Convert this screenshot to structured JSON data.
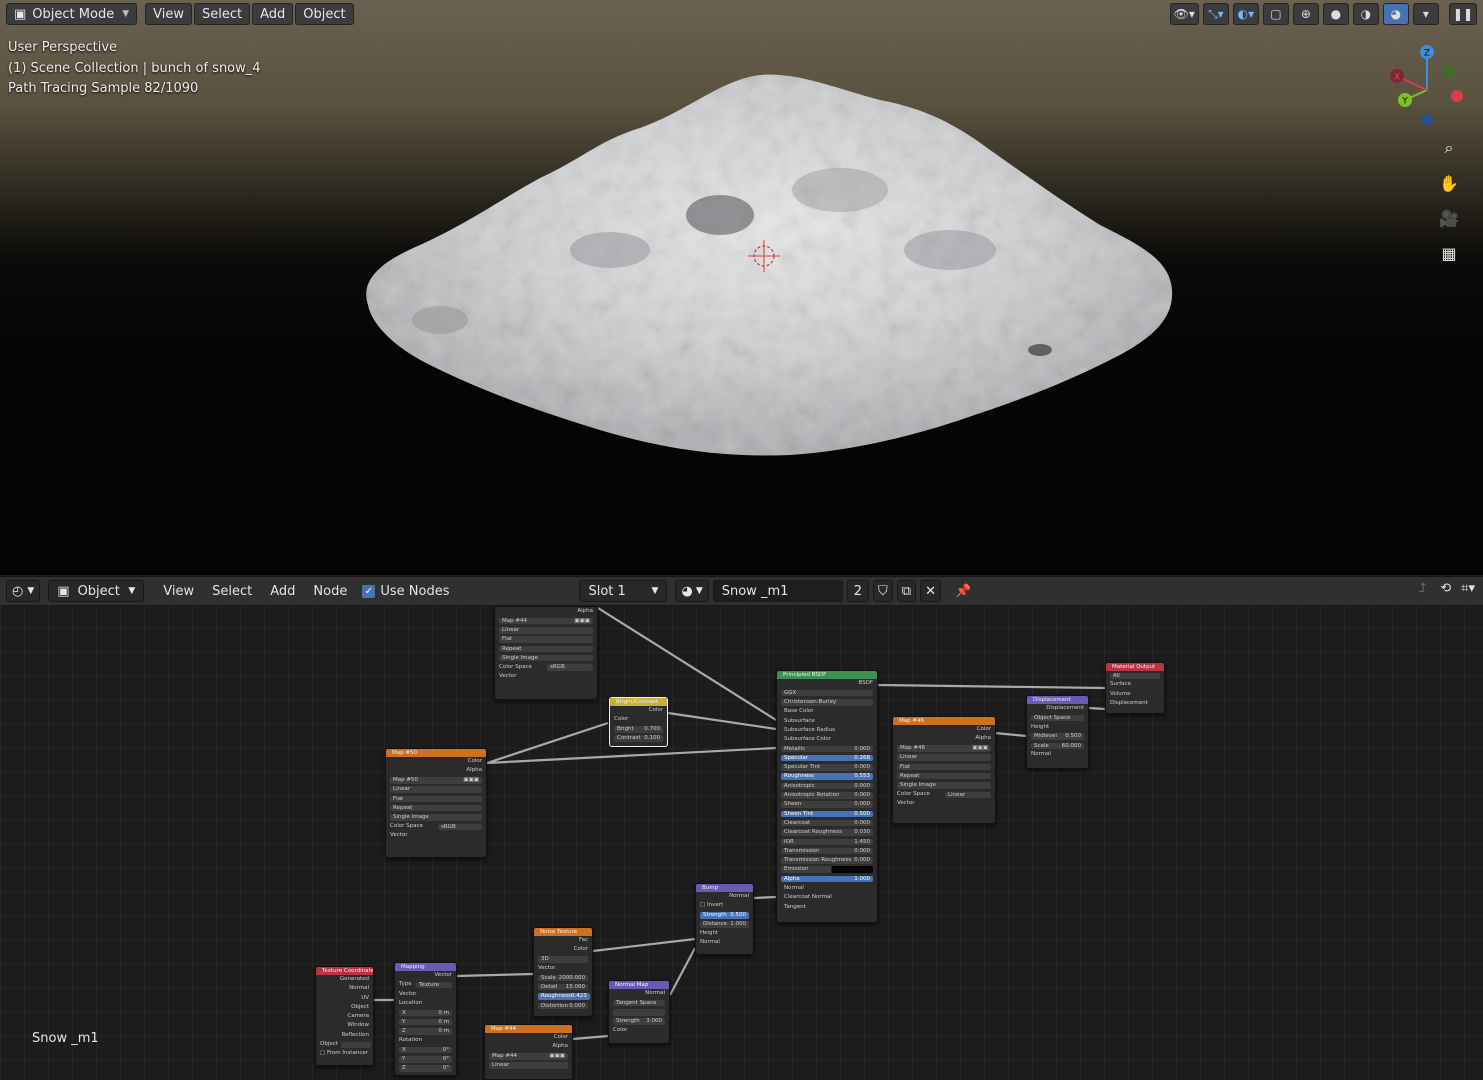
{
  "viewport": {
    "mode_label": "Object Mode",
    "menus": [
      "View",
      "Select",
      "Add",
      "Object"
    ],
    "overlay": {
      "perspective": "User Perspective",
      "collection": "(1) Scene Collection | bunch of snow_4",
      "sample": "Path Tracing Sample 82/1090"
    },
    "gizmo": {
      "x": "X",
      "y": "Y",
      "z": "Z"
    },
    "nav_tools": [
      "zoom-icon",
      "pan-hand-icon",
      "camera-icon",
      "grid-ortho-icon"
    ]
  },
  "node_editor": {
    "object_label": "Object",
    "menus": [
      "View",
      "Select",
      "Add",
      "Node"
    ],
    "use_nodes_label": "Use Nodes",
    "slot_label": "Slot 1",
    "material_name": "Snow _m1",
    "user_count": "2",
    "footer_material": "Snow _m1"
  },
  "nodes": {
    "map44top": {
      "title": "",
      "alpha": "Alpha",
      "img": "Map #44",
      "interp": "Linear",
      "proj": "Flat",
      "ext": "Repeat",
      "src": "Single Image",
      "cs_label": "Color Space",
      "cs_val": "sRGB",
      "vector": "Vector"
    },
    "bright": {
      "title": "Bright/Contrast",
      "color_out": "Color",
      "color_in": "Color",
      "bright": "Bright",
      "bright_val": "0.700",
      "contrast": "Contrast",
      "contrast_val": "0.100"
    },
    "map50": {
      "title": "Map #50",
      "color": "Color",
      "alpha": "Alpha",
      "img": "Map #50",
      "interp": "Linear",
      "proj": "Flat",
      "ext": "Repeat",
      "src": "Single Image",
      "cs_label": "Color Space",
      "cs_val": "sRGB",
      "vector": "Vector"
    },
    "principled": {
      "title": "Principled BSDF",
      "out": "BSDF",
      "dist": "GGX",
      "sss": "Christensen-Burley",
      "rows": [
        {
          "l": "Base Color",
          "v": ""
        },
        {
          "l": "Subsurface",
          "v": ""
        },
        {
          "l": "Subsurface Radius",
          "v": ""
        },
        {
          "l": "Subsurface Color",
          "v": ""
        },
        {
          "l": "Metallic",
          "v": "0.000"
        },
        {
          "l": "Specular",
          "v": "0.268"
        },
        {
          "l": "Specular Tint",
          "v": "0.000"
        },
        {
          "l": "Roughness",
          "v": "0.553"
        },
        {
          "l": "Anisotropic",
          "v": "0.000"
        },
        {
          "l": "Anisotropic Rotation",
          "v": "0.000"
        },
        {
          "l": "Sheen",
          "v": "0.000"
        },
        {
          "l": "Sheen Tint",
          "v": "0.500"
        },
        {
          "l": "Clearcoat",
          "v": "0.000"
        },
        {
          "l": "Clearcoat Roughness",
          "v": "0.030"
        },
        {
          "l": "IOR",
          "v": "1.450"
        },
        {
          "l": "Transmission",
          "v": "0.000"
        },
        {
          "l": "Transmission Roughness",
          "v": "0.000"
        },
        {
          "l": "Emission",
          "v": ""
        },
        {
          "l": "Alpha",
          "v": "1.000"
        },
        {
          "l": "Normal",
          "v": ""
        },
        {
          "l": "Clearcoat Normal",
          "v": ""
        },
        {
          "l": "Tangent",
          "v": ""
        }
      ]
    },
    "map46": {
      "title": "Map #46",
      "color": "Color",
      "alpha": "Alpha",
      "img": "Map #46",
      "interp": "Linear",
      "proj": "Flat",
      "ext": "Repeat",
      "src": "Single Image",
      "cs_label": "Color Space",
      "cs_val": "Linear",
      "vector": "Vector"
    },
    "displacement": {
      "title": "Displacement",
      "out": "Displacement",
      "space": "Object Space",
      "height": "Height",
      "mid": "Midlevel",
      "mid_val": "0.500",
      "scale": "Scale",
      "scale_val": "60.000",
      "normal": "Normal"
    },
    "matout": {
      "title": "Material Output",
      "target": "All",
      "surface": "Surface",
      "volume": "Volume",
      "disp": "Displacement"
    },
    "bump": {
      "title": "Bump",
      "normal_out": "Normal",
      "invert": "Invert",
      "strength": "Strength",
      "strength_val": "0.500",
      "distance": "Distance",
      "distance_val": "1.000",
      "height": "Height",
      "normal": "Normal"
    },
    "noise": {
      "title": "Noise Texture",
      "fac": "Fac",
      "color": "Color",
      "dim": "3D",
      "vector": "Vector",
      "scale": "Scale",
      "scale_val": "2000.000",
      "detail": "Detail",
      "detail_val": "15.000",
      "rough": "Roughness",
      "rough_val": "0.423",
      "distortion": "Distortion",
      "distortion_val": "0.000"
    },
    "normalmap": {
      "title": "Normal Map",
      "normal_out": "Normal",
      "space": "Tangent Space",
      "strength": "Strength",
      "strength_val": "3.000",
      "color": "Color"
    },
    "texcoord": {
      "title": "Texture Coordinate",
      "outs": [
        "Generated",
        "Normal",
        "UV",
        "Object",
        "Camera",
        "Window",
        "Reflection"
      ],
      "object_label": "Object",
      "instancer": "From Instancer"
    },
    "mapping": {
      "title": "Mapping",
      "vector_out": "Vector",
      "type_label": "Type",
      "type_val": "Texture",
      "vector_in": "Vector",
      "location": "Location",
      "rotation": "Rotation",
      "lx": "0 m",
      "ly": "0 m",
      "lz": "0 m",
      "rx": "0°",
      "ry": "0°",
      "rz": "0°",
      "x": "X",
      "y": "Y",
      "z": "Z"
    },
    "map44b": {
      "title": "Map #44",
      "color": "Color",
      "alpha": "Alpha",
      "img": "Map #44",
      "interp": "Linear"
    }
  },
  "colors": {
    "texture_header": "#d0701f",
    "shader_header": "#3d9150",
    "vector_header": "#6b59b6",
    "output_header": "#b93343",
    "color_header": "#c9b233",
    "accent_blue": "#4772b3"
  }
}
